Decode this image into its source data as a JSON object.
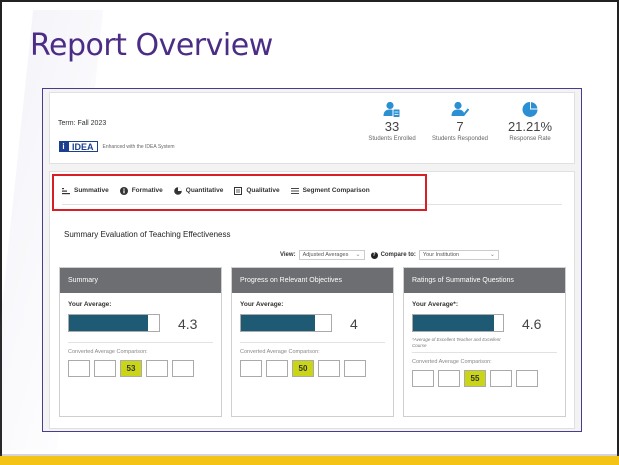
{
  "slide": {
    "title": "Report Overview"
  },
  "header": {
    "term": "Term: Fall 2023",
    "logo_mark": "i",
    "logo_text": "IDEA",
    "logo_sub": "Enhanced with the IDEA System",
    "stats": [
      {
        "icon": "students-enrolled-icon",
        "value": "33",
        "label": "Students Enrolled"
      },
      {
        "icon": "students-responded-icon",
        "value": "7",
        "label": "Students Responded"
      },
      {
        "icon": "pie-chart-icon",
        "value": "21.21%",
        "label": "Response Rate"
      }
    ]
  },
  "tabs": [
    {
      "label": "Summative",
      "icon": "summative-icon"
    },
    {
      "label": "Formative",
      "icon": "info-icon"
    },
    {
      "label": "Quantitative",
      "icon": "pie-icon"
    },
    {
      "label": "Qualitative",
      "icon": "comment-icon"
    },
    {
      "label": "Segment Comparison",
      "icon": "sliders-icon"
    }
  ],
  "section": {
    "title": "Summary Evaluation of Teaching Effectiveness",
    "view_label": "View:",
    "view_value": "Adjusted Averages",
    "compare_label": "Compare to:",
    "compare_value": "Your Institution"
  },
  "panels": [
    {
      "title": "Summary",
      "avg_label": "Your Average:",
      "value": "4.3",
      "fill": 0.88,
      "note": "",
      "conv_label": "Converted Average Comparison:",
      "boxes": [
        "",
        "",
        "53",
        "",
        ""
      ],
      "highlight_index": 2
    },
    {
      "title": "Progress on Relevant Objectives",
      "avg_label": "Your Average:",
      "value": "4",
      "fill": 0.82,
      "note": "",
      "conv_label": "Converted Average Comparison:",
      "boxes": [
        "",
        "",
        "50",
        "",
        ""
      ],
      "highlight_index": 2
    },
    {
      "title": "Ratings of Summative Questions",
      "avg_label": "Your Average*:",
      "value": "4.6",
      "fill": 0.9,
      "note": "*Average of Excellent Teacher and Excellent Course",
      "conv_label": "Converted Average Comparison:",
      "boxes": [
        "",
        "",
        "55",
        "",
        ""
      ],
      "highlight_index": 2
    }
  ],
  "colors": {
    "title": "#4b2d86",
    "accent_bar": "#f3c316",
    "fill": "#1f5a74",
    "highlight": "#cad518",
    "outline": "#d81f26"
  }
}
